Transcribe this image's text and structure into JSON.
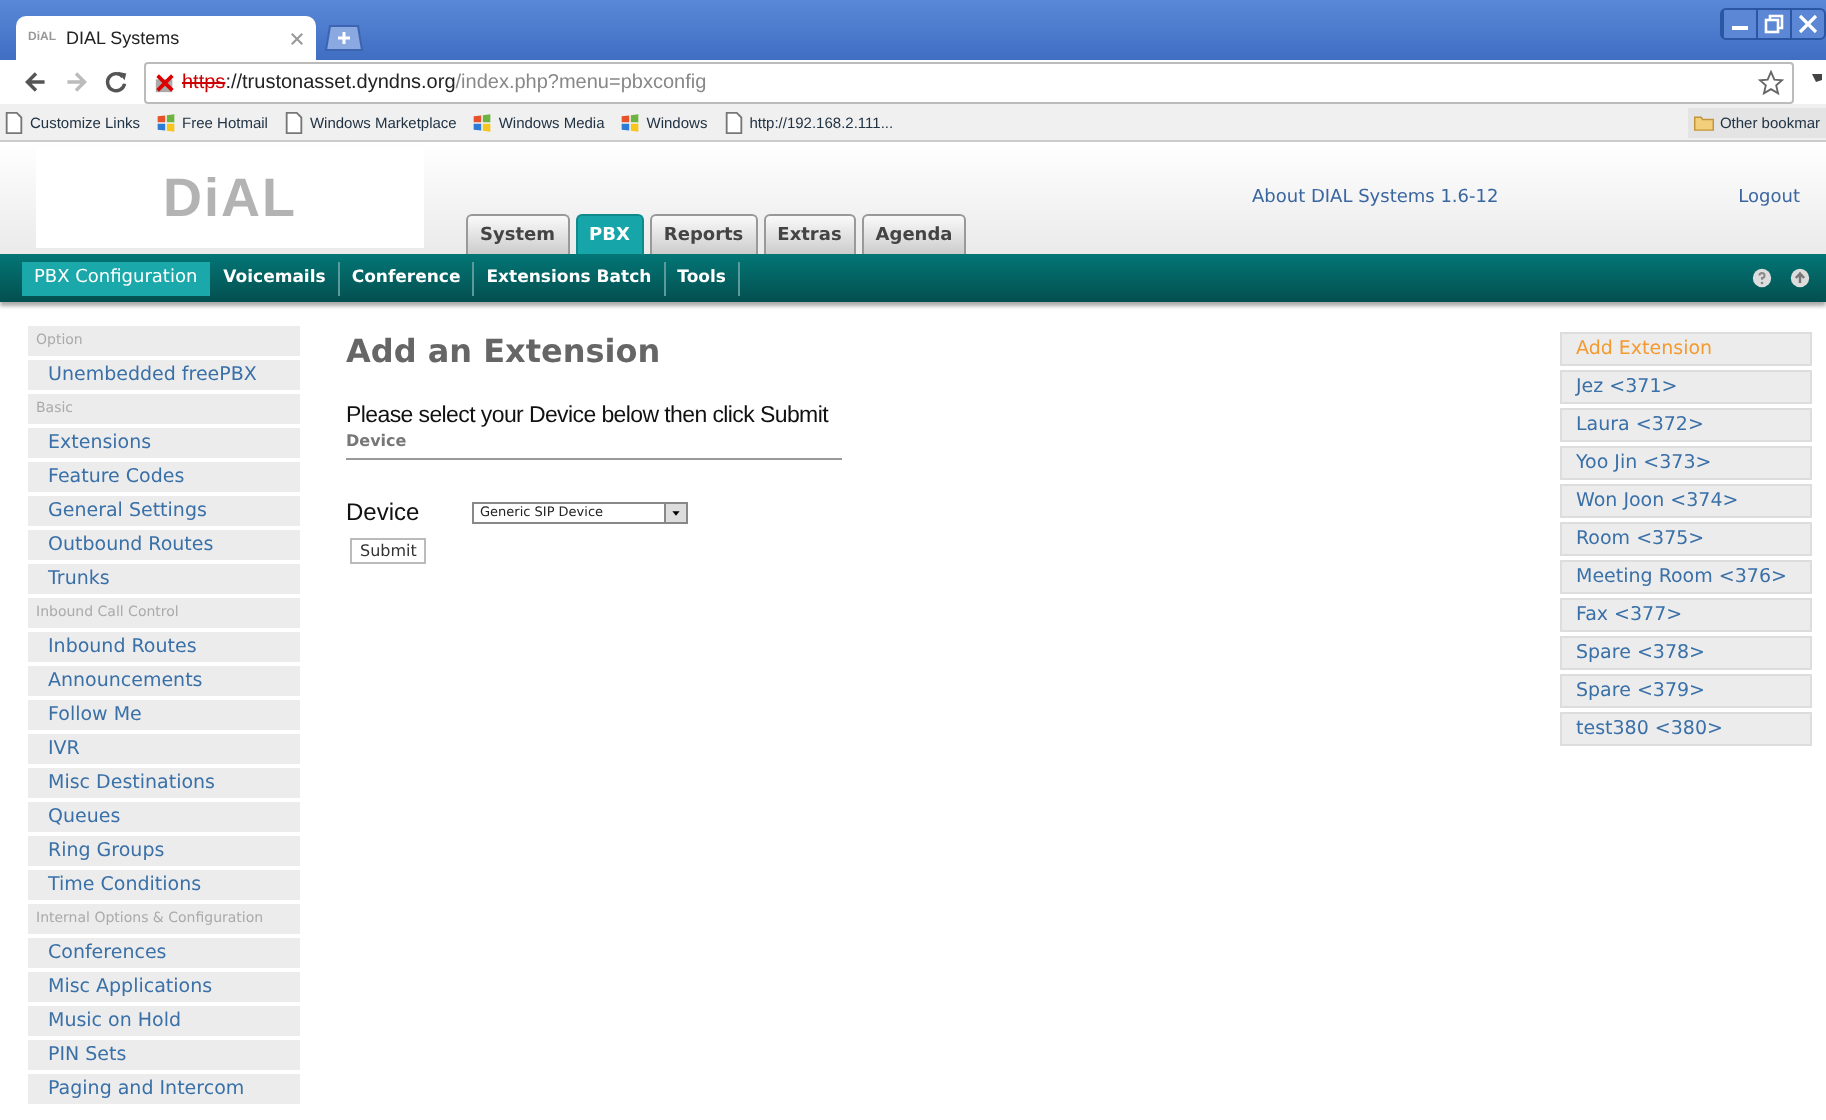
{
  "browser": {
    "tab_title": "DIAL Systems",
    "tab_favicon": "DiAL",
    "url": {
      "scheme": "https",
      "insecure": true,
      "host": "://trustonasset.dyndns.org",
      "path": "/index.php?menu=pbxconfig"
    },
    "bookmarks": [
      {
        "label": "Customize Links",
        "kind": "page"
      },
      {
        "label": "Free Hotmail",
        "kind": "windows"
      },
      {
        "label": "Windows Marketplace",
        "kind": "page"
      },
      {
        "label": "Windows Media",
        "kind": "windows"
      },
      {
        "label": "Windows",
        "kind": "windows"
      },
      {
        "label": "http://192.168.2.111...",
        "kind": "page"
      }
    ],
    "other_bookmarks": "Other bookmar"
  },
  "header": {
    "logo": "DiAL",
    "about": "About DIAL Systems 1.6-12",
    "logout": "Logout",
    "tabs": [
      {
        "label": "System",
        "selected": false
      },
      {
        "label": "PBX",
        "selected": true
      },
      {
        "label": "Reports",
        "selected": false
      },
      {
        "label": "Extras",
        "selected": false
      },
      {
        "label": "Agenda",
        "selected": false
      }
    ]
  },
  "subnav": [
    {
      "label": "PBX Configuration",
      "selected": true
    },
    {
      "label": "Voicemails",
      "selected": false
    },
    {
      "label": "Conference",
      "selected": false
    },
    {
      "label": "Extensions Batch",
      "selected": false
    },
    {
      "label": "Tools",
      "selected": false
    }
  ],
  "sidebar": {
    "items": [
      {
        "label": "Option",
        "kind": "header"
      },
      {
        "label": "Unembedded freePBX",
        "kind": "link"
      },
      {
        "label": "Basic",
        "kind": "header"
      },
      {
        "label": "Extensions",
        "kind": "link"
      },
      {
        "label": "Feature Codes",
        "kind": "link"
      },
      {
        "label": "General Settings",
        "kind": "link"
      },
      {
        "label": "Outbound Routes",
        "kind": "link"
      },
      {
        "label": "Trunks",
        "kind": "link"
      },
      {
        "label": "Inbound Call Control",
        "kind": "header"
      },
      {
        "label": "Inbound Routes",
        "kind": "link"
      },
      {
        "label": "Announcements",
        "kind": "link"
      },
      {
        "label": "Follow Me",
        "kind": "link"
      },
      {
        "label": "IVR",
        "kind": "link"
      },
      {
        "label": "Misc Destinations",
        "kind": "link"
      },
      {
        "label": "Queues",
        "kind": "link"
      },
      {
        "label": "Ring Groups",
        "kind": "link"
      },
      {
        "label": "Time Conditions",
        "kind": "link"
      },
      {
        "label": "Internal Options & Configuration",
        "kind": "header"
      },
      {
        "label": "Conferences",
        "kind": "link"
      },
      {
        "label": "Misc Applications",
        "kind": "link"
      },
      {
        "label": "Music on Hold",
        "kind": "link"
      },
      {
        "label": "PIN Sets",
        "kind": "link"
      },
      {
        "label": "Paging and Intercom",
        "kind": "link"
      }
    ]
  },
  "main": {
    "title": "Add an Extension",
    "instructions": "Please select your Device below then click Submit",
    "section": "Device",
    "field_label": "Device",
    "device_value": "Generic SIP Device",
    "submit": "Submit"
  },
  "extensions": [
    {
      "label": "Add Extension",
      "selected": true
    },
    {
      "label": "Jez <371>",
      "selected": false
    },
    {
      "label": "Laura <372>",
      "selected": false
    },
    {
      "label": "Yoo Jin <373>",
      "selected": false
    },
    {
      "label": "Won Joon <374>",
      "selected": false
    },
    {
      "label": "Room <375>",
      "selected": false
    },
    {
      "label": "Meeting Room <376>",
      "selected": false
    },
    {
      "label": "Fax <377>",
      "selected": false
    },
    {
      "label": "Spare <378>",
      "selected": false
    },
    {
      "label": "Spare <379>",
      "selected": false
    },
    {
      "label": "test380 <380>",
      "selected": false
    }
  ]
}
